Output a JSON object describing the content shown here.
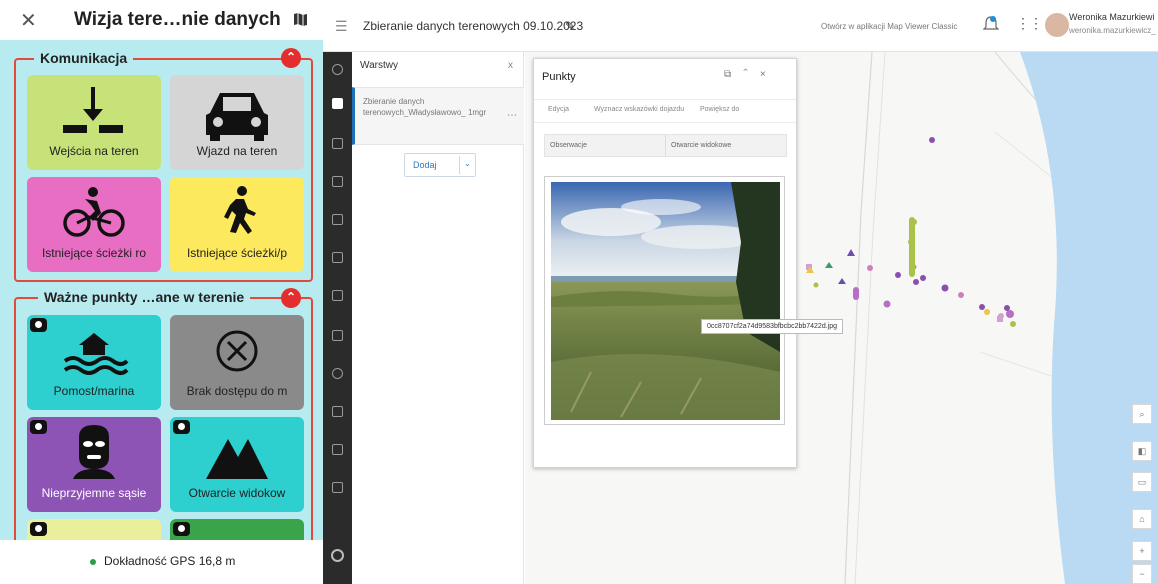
{
  "mobile": {
    "title": "Wizja tere…nie danych",
    "close_icon": "close-icon",
    "map_icon": "map-icon",
    "group1": {
      "title": "Komunikacja",
      "tiles": [
        {
          "label": "Wejścia na teren",
          "icon": "entrance-icon",
          "color": "#c8e27a"
        },
        {
          "label": "Wjazd na teren",
          "icon": "car-icon",
          "color": "#d5d5d5"
        },
        {
          "label": "Istniejące ścieżki ro",
          "icon": "bicycle-icon",
          "color": "#e86ec3"
        },
        {
          "label": "Istniejące ścieżki/p",
          "icon": "walking-icon",
          "color": "#fde95e"
        }
      ]
    },
    "group2": {
      "title": "Ważne punkty …ane w terenie",
      "tiles": [
        {
          "label": "Pomost/marina",
          "icon": "water-icon",
          "color": "#2dcfcf"
        },
        {
          "label": "Brak dostępu do m",
          "icon": "no-access-icon",
          "color": "#8a8a8a"
        },
        {
          "label": "Nieprzyjemne sąsie",
          "icon": "balaclava-icon",
          "color": "#8d54b6"
        },
        {
          "label": "Otwarcie widokow",
          "icon": "mountain-icon",
          "color": "#2dcfcf"
        }
      ]
    },
    "gps_text": "Dokładność GPS 16,8 m"
  },
  "app": {
    "doc_title": "Zbieranie danych terenowych 09.10.2023",
    "open_classic": "Otwórz w aplikacji Map Viewer Classic",
    "user_name": "Weronika Mazurkiewi",
    "user_mail": "weronika.mazurkiewicz_",
    "layers_panel": {
      "title": "Warstwy",
      "layer_name": "Zbieranie danych terenowych_Władysławowo_ 1mgr",
      "add_label": "Dodaj"
    },
    "popup": {
      "title": "Punkty",
      "toolbar": [
        "Edycja",
        "Wyznacz wskazówki dojazdu",
        "Powiększ do"
      ],
      "columns": [
        "Obserwacje",
        "Otwarcie widokowe"
      ],
      "image_name": "0cc8707cf2a74d9583bfbcbc2bb7422d.jpg"
    },
    "map_tools": [
      "search-icon",
      "layers-icon",
      "sketch-icon",
      "home-icon",
      "zoom-in-icon",
      "zoom-out-icon"
    ]
  }
}
